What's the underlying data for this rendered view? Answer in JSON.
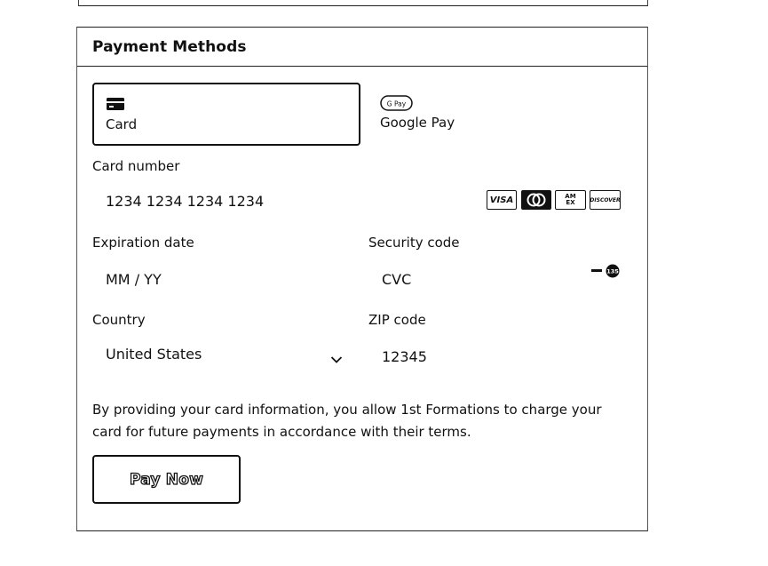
{
  "payment": {
    "title": "Payment Methods",
    "methods": [
      {
        "label": "Card",
        "icon": "credit-card-icon",
        "selected": true
      },
      {
        "label": "Google Pay",
        "icon": "google-pay-icon",
        "badge": "G Pay",
        "selected": false
      }
    ],
    "card_number": {
      "label": "Card number",
      "placeholder": "1234 1234 1234 1234"
    },
    "card_brands": [
      "VISA",
      "AM EX",
      "DISCOVER"
    ],
    "expiration": {
      "label": "Expiration date",
      "placeholder": "MM / YY"
    },
    "security": {
      "label": "Security code",
      "placeholder": "CVC",
      "icon_text": "135"
    },
    "country": {
      "label": "Country",
      "value": "United States"
    },
    "zip": {
      "label": "ZIP code",
      "placeholder": "12345"
    },
    "notice": "By providing your card information, you allow 1st Formations to charge your card for future payments in accordance with their terms.",
    "submit_label": "Pay Now"
  }
}
